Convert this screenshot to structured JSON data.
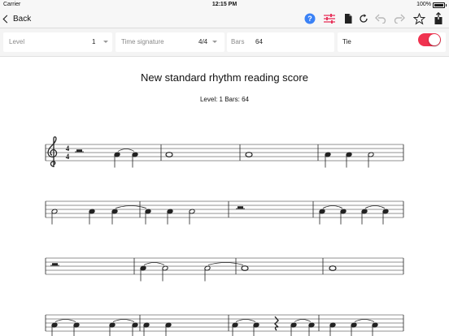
{
  "status_bar": {
    "carrier": "Carrier",
    "time": "12:15 PM",
    "battery": "100%"
  },
  "nav": {
    "back_label": "Back",
    "icons": [
      "help-icon",
      "settings-sliders-icon",
      "document-icon",
      "refresh-icon",
      "undo-icon",
      "redo-icon",
      "star-icon",
      "share-icon"
    ],
    "colors": {
      "help": "#3b82f6",
      "sliders": "#e8335c",
      "dim": "#b8b8b8",
      "dark": "#222222"
    }
  },
  "settings": {
    "level": {
      "label": "Level",
      "value": "1"
    },
    "time_signature": {
      "label": "Time signature",
      "value": "4/4"
    },
    "bars": {
      "label": "Bars",
      "value": "64"
    },
    "tie": {
      "label": "Tie",
      "on": true,
      "color": "#f0324f"
    }
  },
  "score": {
    "title": "New standard rhythm reading score",
    "subtitle": "Level: 1 Bars: 64",
    "time_signature_top": "4",
    "time_signature_bottom": "4"
  }
}
